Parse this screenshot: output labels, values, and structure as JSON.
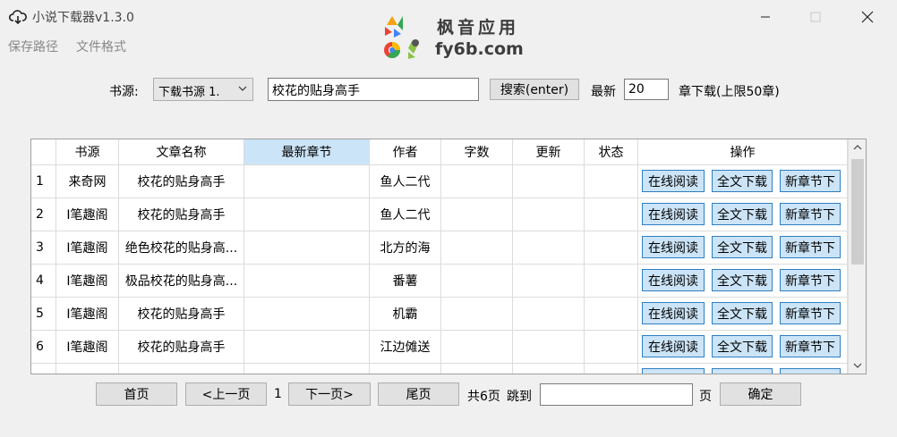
{
  "window": {
    "title": "小说下载器v1.3.0",
    "watermark_line1": "枫音应用",
    "watermark_line2": "fy6b.com"
  },
  "menu": [
    "保存路径",
    "文件格式"
  ],
  "search": {
    "source_label": "书源:",
    "source_value": "下载书源 1.",
    "query": "校花的贴身高手",
    "search_button": "搜索(enter)",
    "latest_label": "最新",
    "latest_count": "20",
    "latest_suffix": "章下载(上限50章)"
  },
  "table": {
    "columns": [
      "",
      "书源",
      "文章名称",
      "最新章节",
      "作者",
      "字数",
      "更新",
      "状态",
      "操作"
    ],
    "rows": [
      {
        "index": "1",
        "source": "来奇网",
        "name": "校花的贴身高手",
        "latest": "",
        "author": "鱼人二代",
        "words": "",
        "updated": "",
        "status": ""
      },
      {
        "index": "2",
        "source": "I笔趣阁",
        "name": "校花的贴身高手",
        "latest": "",
        "author": "鱼人二代",
        "words": "",
        "updated": "",
        "status": ""
      },
      {
        "index": "3",
        "source": "I笔趣阁",
        "name": "绝色校花的贴身高...",
        "latest": "",
        "author": "北方的海",
        "words": "",
        "updated": "",
        "status": ""
      },
      {
        "index": "4",
        "source": "I笔趣阁",
        "name": "极品校花的贴身高...",
        "latest": "",
        "author": "番薯",
        "words": "",
        "updated": "",
        "status": ""
      },
      {
        "index": "5",
        "source": "I笔趣阁",
        "name": "校花的贴身高手",
        "latest": "",
        "author": "机霸",
        "words": "",
        "updated": "",
        "status": ""
      },
      {
        "index": "6",
        "source": "I笔趣阁",
        "name": "校花的贴身高手",
        "latest": "",
        "author": "江边傩送",
        "words": "",
        "updated": "",
        "status": ""
      }
    ],
    "actions": [
      "在线阅读",
      "全文下载",
      "新章节下"
    ]
  },
  "pager": {
    "first": "首页",
    "prev": "<上一页",
    "current": "1",
    "next": "下一页>",
    "last": "尾页",
    "total": "共6页",
    "jump_label": "跳到",
    "jump_value": "",
    "page_suffix": "页",
    "confirm": "确定"
  },
  "colors": {
    "window_bg": "#f0f0f0",
    "action_button_bg": "#cce4f7",
    "action_button_border": "#2e7fc2",
    "active_header_bg": "#cce4f7"
  }
}
